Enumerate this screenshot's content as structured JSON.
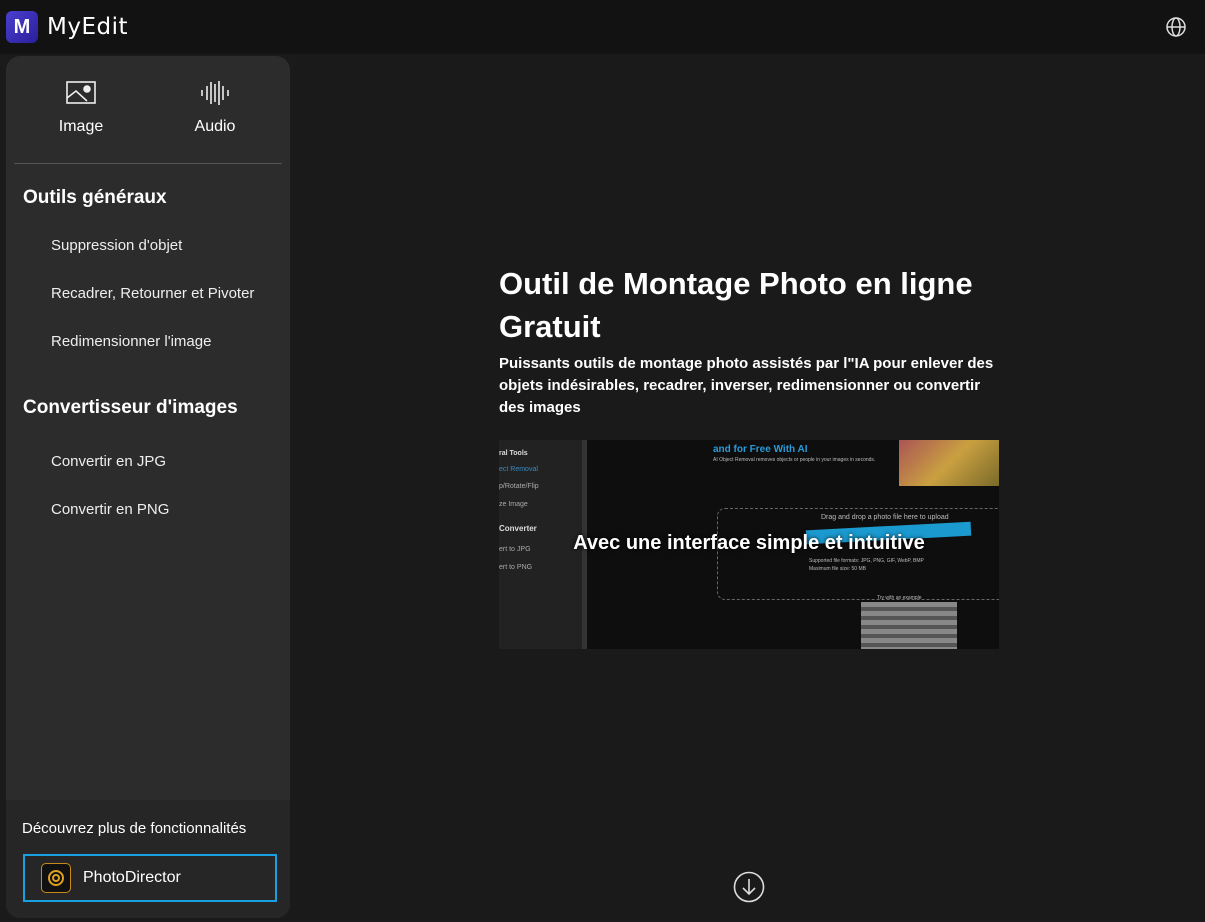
{
  "header": {
    "logo_letter": "M",
    "brand": "MyEdit"
  },
  "sidebar": {
    "modes": [
      {
        "label": "Image",
        "icon": "image-icon"
      },
      {
        "label": "Audio",
        "icon": "audio-wave-icon"
      }
    ],
    "sections": [
      {
        "title": "Outils généraux",
        "items": [
          "Suppression d'objet",
          "Recadrer, Retourner et Pivoter",
          "Redimensionner l'image"
        ]
      },
      {
        "title": "Convertisseur d'images",
        "items": [
          "Convertir en JPG",
          "Convertir en PNG"
        ]
      }
    ],
    "discover": "Découvrez plus de fonctionnalités",
    "photodirector": "PhotoDirector"
  },
  "main": {
    "title": "Outil de Montage Photo en ligne Gratuit",
    "subtitle": "Puissants outils de montage photo assistés par l\"IA pour enlever des objets indésirables, recadrer, inverser, redimensionner ou convertir des images",
    "preview": {
      "caption": "Avec une interface simple et intuitive",
      "side": [
        "ral Tools",
        "ect Removal",
        "p/Rotate/Flip",
        "ze Image",
        "Converter",
        "ert to JPG",
        "ert to PNG"
      ],
      "headline": "and for Free With AI",
      "desc": "AI Object Removal removes objects or people in your images in seconds.",
      "drag": "Drag and drop a photo file here to upload",
      "formats": "Supported file formats: JPG, PNG, GIF, WebP, BMP",
      "maxsize": "Maximum file size: 50 MB",
      "try": "Try with an example"
    }
  }
}
